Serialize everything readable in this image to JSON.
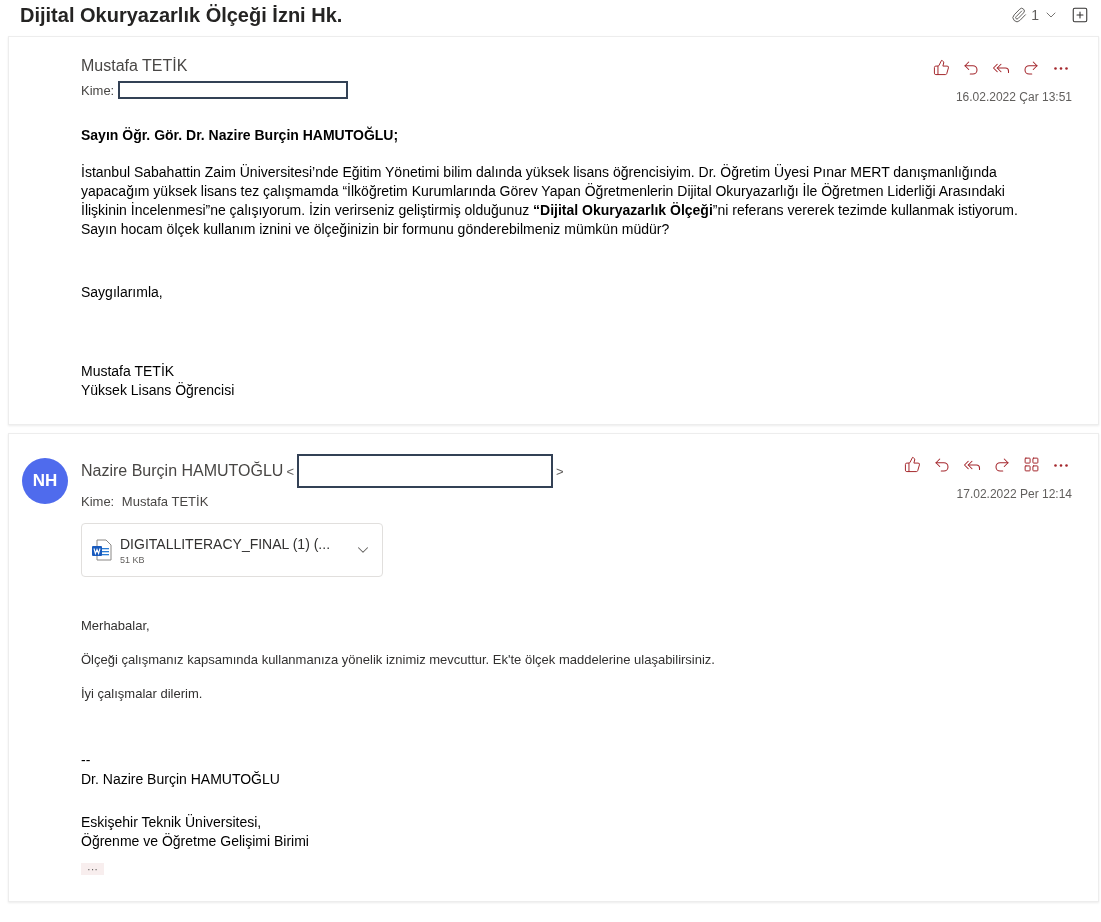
{
  "conversation": {
    "title": "Dijital Okuryazarlık Ölçeği İzni Hk.",
    "attachment_count": "1"
  },
  "messages": [
    {
      "sender": "Mustafa TETİK",
      "sender_address_redacted": false,
      "to_label": "Kime:",
      "recipient_redacted": true,
      "date": "16.02.2022 Çar 13:51",
      "apps_button": false,
      "body": [
        {
          "kind": "greeting",
          "lines": [
            "**Sayın Öğr. Gör. Dr. Nazire Burçin HAMUTOĞLU;**"
          ]
        },
        {
          "kind": "paragraph",
          "lines": [
            "İstanbul Sabahattin Zaim Üniversitesi’nde Eğitim Yönetimi bilim dalında yüksek lisans öğrencisiyim. Dr. Öğretim Üyesi Pınar MERT danışmanlığında yapacağım yüksek lisans tez çalışmamda “İlköğretim Kurumlarında Görev Yapan Öğretmenlerin Dijital Okuryazarlığı İle Öğretmen Liderliği Arasındaki İlişkinin İncelenmesi”ne çalışıyorum. İzin verirseniz geliştirmiş olduğunuz **“Dijital Okuryazarlık Ölçeği**”ni referans vererek tezimde kullanmak istiyorum. Sayın hocam ölçek kullanım iznini ve ölçeğinizin bir formunu gönderebilmeniz mümkün müdür?"
          ]
        },
        {
          "kind": "closing",
          "lines": [
            "Saygılarımla,"
          ]
        },
        {
          "kind": "signature",
          "lines": [
            "Mustafa TETİK",
            "Yüksek Lisans Öğrencisi"
          ]
        }
      ]
    },
    {
      "sender": "Nazire Burçin HAMUTOĞLU",
      "avatar": "NH",
      "sender_address_redacted": true,
      "address_open": "<",
      "address_close": ">",
      "to_label": "Kime:",
      "recipient": "Mustafa TETİK",
      "recipient_redacted": false,
      "date": "17.02.2022 Per 12:14",
      "apps_button": true,
      "attachments": [
        {
          "name": "DIGITALLITERACY_FINAL (1) (...",
          "size": "51 KB"
        }
      ],
      "body": [
        {
          "kind": "note",
          "lines": [
            "Merhabalar,"
          ]
        },
        {
          "kind": "note",
          "lines": [
            "Ölçeği çalışmanız kapsamında kullanmanıza yönelik iznimiz mevcuttur. Ek'te ölçek maddelerine ulaşabilirsiniz."
          ]
        },
        {
          "kind": "note",
          "lines": [
            "İyi çalışmalar dilerim."
          ]
        },
        {
          "kind": "signature",
          "lines": [
            "--",
            "Dr. Nazire Burçin HAMUTOĞLU"
          ]
        },
        {
          "kind": "signature",
          "lines": [
            "Eskişehir Teknik Üniversitesi,",
            "Öğrenme ve Öğretme Gelişimi Birimi"
          ]
        }
      ],
      "more": "···"
    }
  ]
}
